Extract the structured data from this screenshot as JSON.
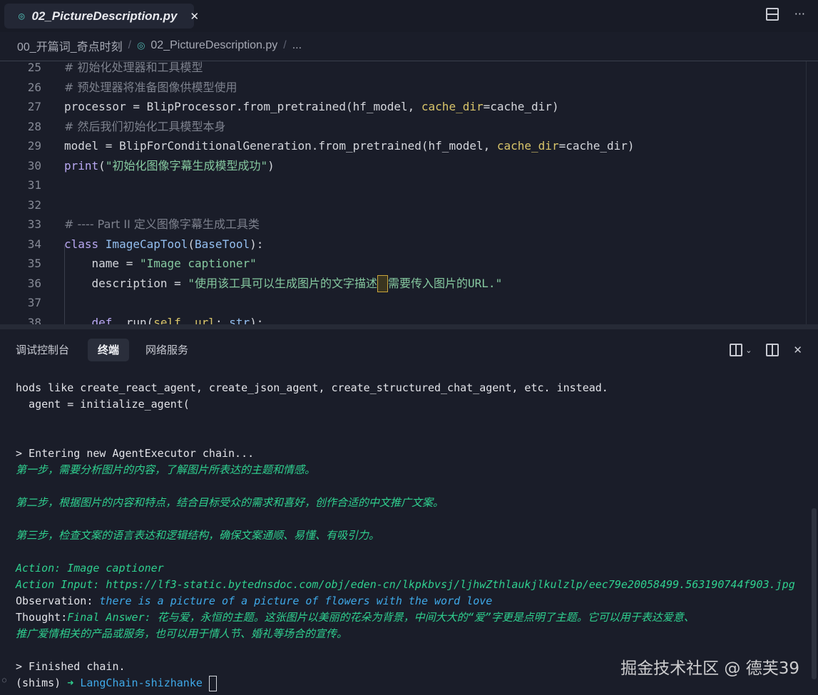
{
  "tab": {
    "file_icon": "python-icon",
    "title": "02_PictureDescription.py",
    "close": "✕"
  },
  "top_actions": {
    "split": "split-editor-icon",
    "more": "···"
  },
  "breadcrumb": {
    "folder": "00_开篇词_奇点时刻",
    "sep": "/",
    "file": "02_PictureDescription.py",
    "more": "..."
  },
  "editor": {
    "lines": [
      {
        "n": "25",
        "t": [
          [
            "c-cm",
            "# 初始化处理器和工具模型"
          ]
        ]
      },
      {
        "n": "26",
        "t": [
          [
            "c-cm",
            "# 预处理器将准备图像供模型使用"
          ]
        ]
      },
      {
        "n": "27",
        "t": [
          [
            "c-fn",
            "processor = BlipProcessor.from_pretrained(hf_model, "
          ],
          [
            "c-arg",
            "cache_dir"
          ],
          [
            "c-fn",
            "=cache_dir)"
          ]
        ]
      },
      {
        "n": "28",
        "t": [
          [
            "c-cm",
            "# 然后我们初始化工具模型本身"
          ]
        ]
      },
      {
        "n": "29",
        "t": [
          [
            "c-fn",
            "model = BlipForConditionalGeneration.from_pretrained(hf_model, "
          ],
          [
            "c-arg",
            "cache_dir"
          ],
          [
            "c-fn",
            "=cache_dir)"
          ]
        ]
      },
      {
        "n": "30",
        "t": [
          [
            "c-kw",
            "print"
          ],
          [
            "c-fn",
            "("
          ],
          [
            "c-str",
            "\"初始化图像字幕生成模型成功\""
          ],
          [
            "c-fn",
            ")"
          ]
        ]
      },
      {
        "n": "31",
        "t": []
      },
      {
        "n": "32",
        "t": []
      },
      {
        "n": "33",
        "t": [
          [
            "c-cm",
            "# ---- Part II 定义图像字幕生成工具类"
          ]
        ]
      },
      {
        "n": "34",
        "t": [
          [
            "c-kw",
            "class "
          ],
          [
            "c-cls",
            "ImageCapTool"
          ],
          [
            "c-fn",
            "("
          ],
          [
            "c-cls",
            "BaseTool"
          ],
          [
            "c-fn",
            "):"
          ]
        ]
      },
      {
        "n": "35",
        "t": [
          [
            "c-fn",
            "    name = "
          ],
          [
            "c-str",
            "\"Image captioner\""
          ]
        ]
      },
      {
        "n": "36",
        "t": [
          [
            "c-fn",
            "    description = "
          ],
          [
            "c-str",
            "\"使用该工具可以生成图片的文字描述"
          ],
          [
            "cursor",
            ""
          ],
          [
            "c-str",
            "需要传入图片的URL.\""
          ]
        ]
      },
      {
        "n": "37",
        "t": []
      },
      {
        "n": "38",
        "t": [
          [
            "c-kw",
            "    def "
          ],
          [
            "c-fn",
            "_run("
          ],
          [
            "c-arg",
            "self"
          ],
          [
            "c-fn",
            ", "
          ],
          [
            "c-arg",
            "url"
          ],
          [
            "c-fn",
            ": "
          ],
          [
            "c-cls",
            "str"
          ],
          [
            "c-fn",
            "):"
          ]
        ]
      }
    ]
  },
  "panel": {
    "tabs": [
      "调试控制台",
      "终端",
      "网络服务"
    ],
    "active": 1,
    "icons": [
      "split-terminal-icon",
      "chevron-down-icon",
      "layout-icon",
      "close-icon"
    ]
  },
  "terminal": {
    "lines": [
      [
        [
          "w",
          "hods like create_react_agent, create_json_agent, create_structured_chat_agent, etc. instead."
        ]
      ],
      [
        [
          "w",
          "  agent = initialize_agent("
        ]
      ],
      [],
      [],
      [
        [
          "w",
          "> Entering new AgentExecutor chain..."
        ]
      ],
      [
        [
          "g",
          "第一步，需要分析图片的内容，了解图片所表达的主题和情感。"
        ]
      ],
      [],
      [
        [
          "g",
          "第二步，根据图片的内容和特点，结合目标受众的需求和喜好，创作合适的中文推广文案。"
        ]
      ],
      [],
      [
        [
          "g",
          "第三步，检查文案的语言表达和逻辑结构，确保文案通顺、易懂、有吸引力。"
        ]
      ],
      [],
      [
        [
          "g",
          "Action: Image captioner"
        ]
      ],
      [
        [
          "g",
          "Action Input: https://lf3-static.bytednsdoc.com/obj/eden-cn/lkpkbvsj/ljhwZthlaukjlkulzlp/eec79e20058499.563190744f903.jpg"
        ]
      ],
      [
        [
          "w",
          "Observation: "
        ],
        [
          "b",
          "there is a picture of a picture of flowers with the word love"
        ]
      ],
      [
        [
          "w",
          "Thought:"
        ],
        [
          "g",
          "Final Answer: 花与爱，永恒的主题。这张图片以美丽的花朵为背景，中间大大的“爱”字更是点明了主题。它可以用于表达爱意、"
        ]
      ],
      [
        [
          "g",
          "推广爱情相关的产品或服务，也可以用于情人节、婚礼等场合的宣传。"
        ]
      ],
      [],
      [
        [
          "w",
          "> Finished chain."
        ]
      ],
      [
        [
          "w",
          "(shims) "
        ],
        [
          "arrow",
          "➜ "
        ],
        [
          "dir",
          "LangChain-shizhanke "
        ],
        [
          "tcursor",
          ""
        ]
      ]
    ]
  },
  "watermark": "掘金技术社区 @ 德芙39"
}
